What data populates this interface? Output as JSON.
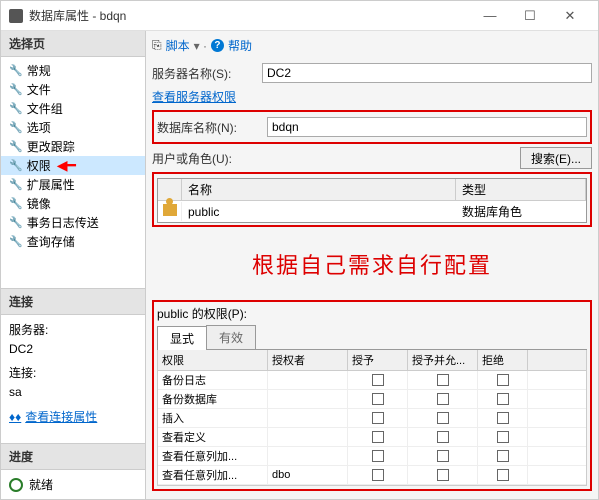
{
  "window": {
    "title": "数据库属性 - bdqn"
  },
  "sidebar": {
    "select_header": "选择页",
    "items": [
      {
        "label": "常规"
      },
      {
        "label": "文件"
      },
      {
        "label": "文件组"
      },
      {
        "label": "选项"
      },
      {
        "label": "更改跟踪"
      },
      {
        "label": "权限",
        "selected": true
      },
      {
        "label": "扩展属性"
      },
      {
        "label": "镜像"
      },
      {
        "label": "事务日志传送"
      },
      {
        "label": "查询存储"
      }
    ],
    "conn_header": "连接",
    "server_label": "服务器:",
    "server_value": "DC2",
    "conn_label": "连接:",
    "conn_value": "sa",
    "view_conn_props": "查看连接属性",
    "progress_header": "进度",
    "progress_status": "就绪"
  },
  "toolbar": {
    "script": "脚本",
    "help": "帮助"
  },
  "form": {
    "server_name_label": "服务器名称(S):",
    "server_name_value": "DC2",
    "view_server_perm": "查看服务器权限",
    "db_name_label": "数据库名称(N):",
    "db_name_value": "bdqn",
    "user_role_label": "用户或角色(U):",
    "search_btn": "搜索(E)..."
  },
  "grid1": {
    "col_name": "名称",
    "col_type": "类型",
    "row_name": "public",
    "row_type": "数据库角色"
  },
  "annotation": "根据自己需求自行配置",
  "perm": {
    "title": "public 的权限(P):",
    "tab_explicit": "显式",
    "tab_effective": "有效",
    "col_perm": "权限",
    "col_grantor": "授权者",
    "col_grant": "授予",
    "col_withgrant": "授予并允...",
    "col_deny": "拒绝",
    "rows": [
      {
        "p": "备份日志",
        "g": "",
        "grant": false,
        "wg": false,
        "deny": false
      },
      {
        "p": "备份数据库",
        "g": "",
        "grant": false,
        "wg": false,
        "deny": false
      },
      {
        "p": "插入",
        "g": "",
        "grant": false,
        "wg": false,
        "deny": false
      },
      {
        "p": "查看定义",
        "g": "",
        "grant": false,
        "wg": false,
        "deny": false
      },
      {
        "p": "查看任意列加...",
        "g": "",
        "grant": false,
        "wg": false,
        "deny": false
      },
      {
        "p": "查看任意列加...",
        "g": "dbo",
        "grant": false,
        "wg": false,
        "deny": false
      }
    ]
  }
}
